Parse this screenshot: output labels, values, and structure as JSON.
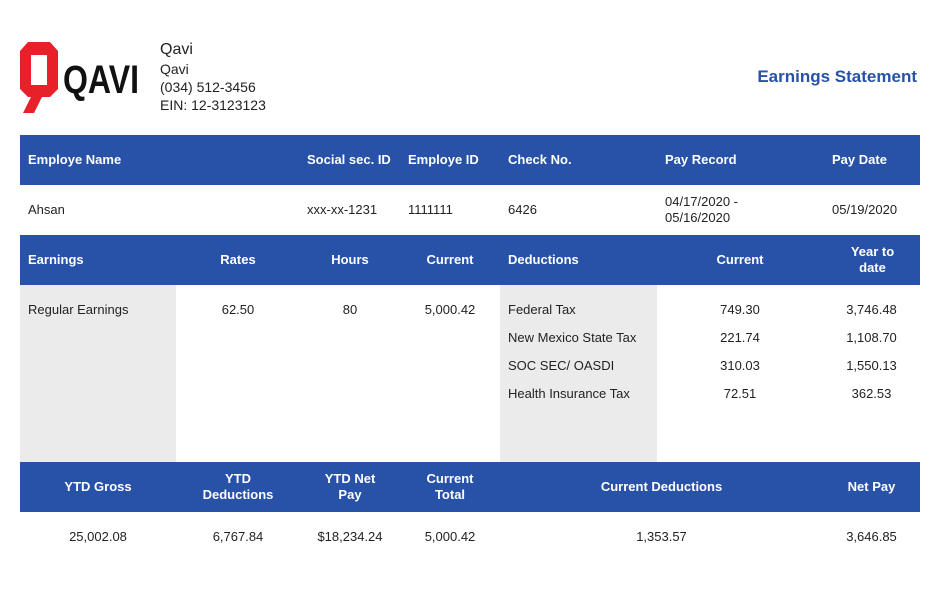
{
  "company": {
    "logo_text": "QAVI",
    "name": "Qavi",
    "subname": "Qavi",
    "phone": "(034) 512-3456",
    "ein": "EIN: 12-3123123"
  },
  "title": "Earnings Statement",
  "colors": {
    "header_blue": "#2851a8",
    "logo_red": "#e8202a",
    "shaded_gray": "#ebebeb"
  },
  "employee_header": {
    "name": "Employe Name",
    "ssn": "Social sec. ID",
    "id": "Employe ID",
    "check": "Check No.",
    "pay_record": "Pay Record",
    "pay_date": "Pay Date"
  },
  "employee": {
    "name": "Ahsan",
    "ssn": "xxx-xx-1231",
    "id": "1111111",
    "check": "6426",
    "pay_record": "04/17/2020 - 05/16/2020",
    "pay_date": "05/19/2020"
  },
  "earnings_header": {
    "earnings": "Earnings",
    "rates": "Rates",
    "hours": "Hours",
    "current": "Current",
    "deductions": "Deductions",
    "ded_current": "Current",
    "ytd": "Year to date"
  },
  "earnings": [
    {
      "label": "Regular Earnings",
      "rate": "62.50",
      "hours": "80",
      "current": "5,000.42"
    }
  ],
  "deductions": [
    {
      "label": "Federal Tax",
      "current": "749.30",
      "ytd": "3,746.48"
    },
    {
      "label": "New Mexico State Tax",
      "current": "221.74",
      "ytd": "1,108.70"
    },
    {
      "label": "SOC SEC/ OASDI",
      "current": "310.03",
      "ytd": "1,550.13"
    },
    {
      "label": "Health Insurance Tax",
      "current": "72.51",
      "ytd": "362.53"
    }
  ],
  "summary_header": {
    "ytd_gross": "YTD Gross",
    "ytd_deductions": "YTD Deductions",
    "ytd_net": "YTD Net Pay",
    "current_total": "Current Total",
    "current_deductions": "Current Deductions",
    "net_pay": "Net Pay"
  },
  "summary": {
    "ytd_gross": "25,002.08",
    "ytd_deductions": "6,767.84",
    "ytd_net": "$18,234.24",
    "current_total": "5,000.42",
    "current_deductions": "1,353.57",
    "net_pay": "3,646.85"
  }
}
